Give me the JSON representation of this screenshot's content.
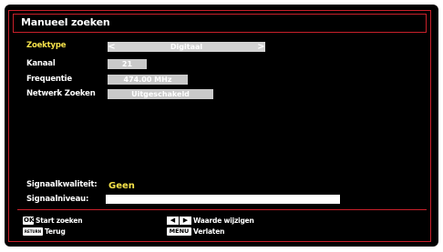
{
  "window": {
    "title": "Manueel zoeken"
  },
  "fields": [
    {
      "label": "Zoektype",
      "value": "Digitaal",
      "left_arrow": "<",
      "right_arrow": ">"
    },
    {
      "label": "Kanaal",
      "value": "21"
    },
    {
      "label": "Frequentie",
      "value": "474.00 MHz"
    },
    {
      "label": "Netwerk Zoeken",
      "value": "Uitgeschakeld"
    }
  ],
  "signal": {
    "quality_label": "Signaalkwaliteit:",
    "quality_value": "Geen",
    "level_label": "Signaalniveau:",
    "level_fraction": 1.0
  },
  "footer": {
    "ok_key": "OK",
    "ok_text": "Start zoeken",
    "return_key": "RETURN",
    "return_text": "Terug",
    "arrows_key_left": "◀",
    "arrows_key_right": "▶",
    "arrows_text": "Waarde wijzigen",
    "menu_key": "MENU",
    "menu_text": "Verlaten"
  },
  "colors": {
    "accent": "#c8202a",
    "highlight_label": "#f6e24a",
    "background": "#000000",
    "field_bg": "#c9c9c9"
  }
}
